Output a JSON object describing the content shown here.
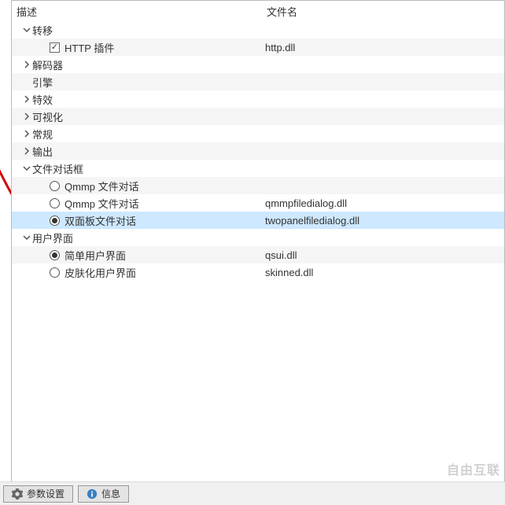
{
  "columns": {
    "desc": "描述",
    "file": "文件名"
  },
  "tree": [
    {
      "type": "group",
      "label": "转移",
      "expanded": true,
      "depth": 0,
      "alt": false
    },
    {
      "type": "check",
      "label": "HTTP 插件",
      "file": "http.dll",
      "checked": true,
      "depth": 1,
      "alt": true
    },
    {
      "type": "group",
      "label": "解码器",
      "expanded": false,
      "depth": 0,
      "alt": false
    },
    {
      "type": "plain",
      "label": "引擎",
      "depth": 0,
      "alt": true,
      "indentExtra": true
    },
    {
      "type": "group",
      "label": "特效",
      "expanded": false,
      "depth": 0,
      "alt": false
    },
    {
      "type": "group",
      "label": "可视化",
      "expanded": false,
      "depth": 0,
      "alt": true
    },
    {
      "type": "group",
      "label": "常规",
      "expanded": false,
      "depth": 0,
      "alt": false
    },
    {
      "type": "group",
      "label": "输出",
      "expanded": false,
      "depth": 0,
      "alt": true
    },
    {
      "type": "group",
      "label": "文件对话框",
      "expanded": true,
      "depth": 0,
      "alt": false
    },
    {
      "type": "radio",
      "label": "Qmmp 文件对话",
      "file": "",
      "on": false,
      "depth": 1,
      "alt": true
    },
    {
      "type": "radio",
      "label": "Qmmp 文件对话",
      "file": "qmmpfiledialog.dll",
      "on": false,
      "depth": 1,
      "alt": false
    },
    {
      "type": "radio",
      "label": "双面板文件对话",
      "file": "twopanelfiledialog.dll",
      "on": true,
      "depth": 1,
      "alt": false,
      "selected": true
    },
    {
      "type": "group",
      "label": "用户界面",
      "expanded": true,
      "depth": 0,
      "alt": false
    },
    {
      "type": "radio",
      "label": "简单用户界面",
      "file": "qsui.dll",
      "on": true,
      "depth": 1,
      "alt": true
    },
    {
      "type": "radio",
      "label": "皮肤化用户界面",
      "file": "skinned.dll",
      "on": false,
      "depth": 1,
      "alt": false
    }
  ],
  "buttons": {
    "settings": "参数设置",
    "info": "信息"
  },
  "watermark": "自由互联"
}
